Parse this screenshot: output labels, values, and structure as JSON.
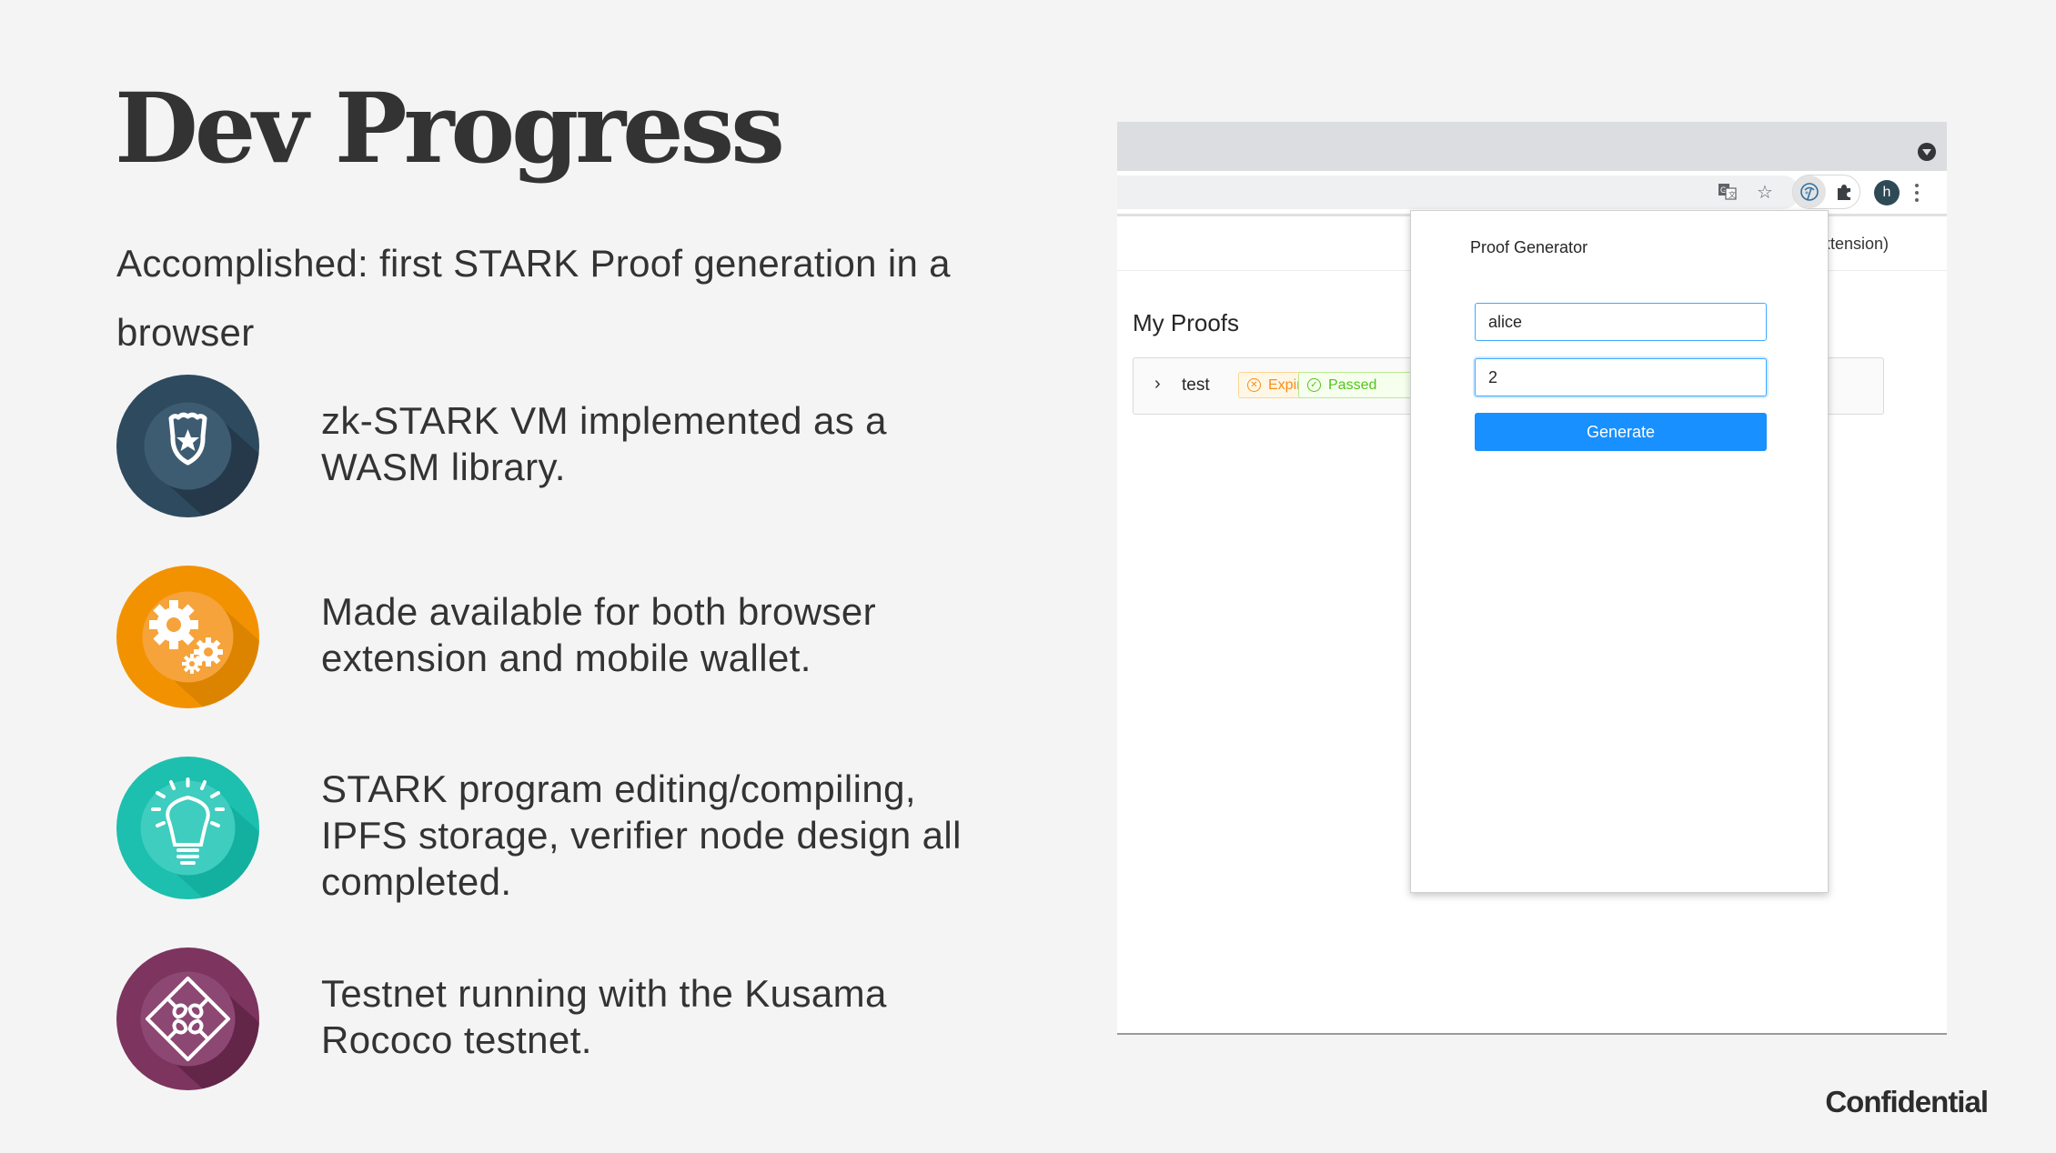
{
  "slide": {
    "title": "Dev Progress",
    "subtitle": "Accomplished: first STARK Proof generation in a browser",
    "bullets": [
      {
        "icon": "police-badge-icon",
        "color": "#2e4a5f",
        "text": "zk-STARK VM implemented as a WASM library."
      },
      {
        "icon": "gears-icon",
        "color": "#f39200",
        "text": "Made available for both browser extension and mobile wallet."
      },
      {
        "icon": "lightbulb-icon",
        "color": "#1dbfae",
        "text": "STARK program editing/compiling, IPFS storage, verifier node design all completed."
      },
      {
        "icon": "puzzle-icon",
        "color": "#7d345f",
        "text": "Testnet running with the Kusama Rococo testnet."
      }
    ],
    "footer": "Confidential"
  },
  "browser": {
    "toolbar_icons": [
      "translate-icon",
      "bookmark-star-icon",
      "extension-proof-icon",
      "extensions-puzzle-icon"
    ],
    "avatar_letter": "h",
    "header_text_partial": "xtension)",
    "page": {
      "heading": "My Proofs",
      "proofs": [
        {
          "name": "test",
          "badges": [
            {
              "label": "Expired",
              "status": "expired",
              "color": "#fa8c16"
            },
            {
              "label": "Passed",
              "status": "passed",
              "color": "#52c41a"
            }
          ]
        }
      ]
    },
    "popup": {
      "title": "Proof Generator",
      "input_1_value": "alice",
      "input_2_value": "2",
      "button_label": "Generate",
      "button_color": "#1890ff"
    }
  }
}
